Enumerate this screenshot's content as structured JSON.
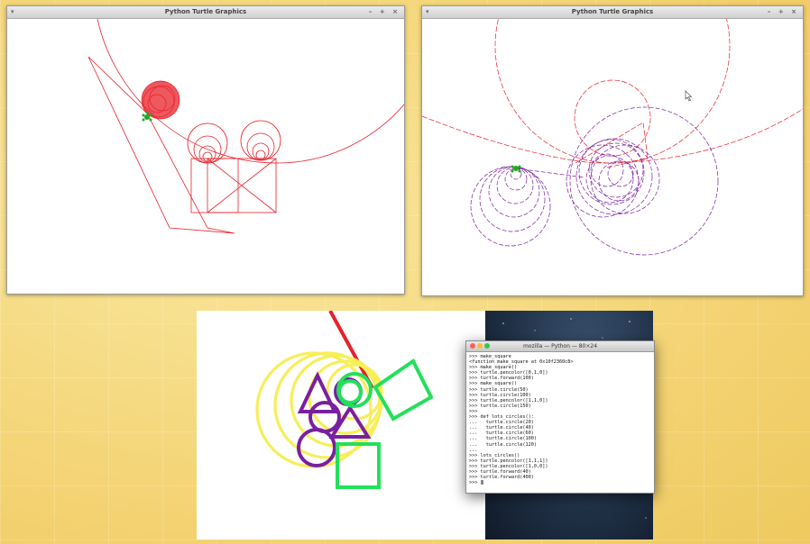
{
  "window_left": {
    "title": "Python Turtle Graphics",
    "menu": "▾",
    "controls": "– + ×"
  },
  "window_right": {
    "title": "Python Turtle Graphics",
    "menu": "▾",
    "controls": "– + ×"
  },
  "terminal": {
    "title": "mozilla — Python — 80×24",
    "lines": [
      ">>> make_square",
      "<function make_square at 0x10f2360c8>",
      ">>> make_square()",
      ">>> turtle.pencolor([0,1,0])",
      ">>> turtle.forward(100)",
      ">>> make_square()",
      ">>> turtle.circle(50)",
      ">>> turtle.circle(100)",
      ">>> turtle.pencolor([1,1,0])",
      ">>> turtle.circle(150)",
      ">>>",
      ">>> def lots_circles():",
      "...   turtle.circle(20)",
      "...   turtle.circle(40)",
      "...   turtle.circle(60)",
      "...   turtle.circle(100)",
      "...   turtle.circle(120)",
      "...",
      ">>> lots_circles()",
      ">>> turtle.pencolor([1,1,1])",
      ">>> turtle.pencolor([1,0,0])",
      ">>> turtle.forward(40)",
      ">>> turtle.forward(400)",
      ">>> "
    ]
  },
  "colors": {
    "red": "#e8202a",
    "purple": "#7a1fa0",
    "green": "#22e05a",
    "yellow": "#f7ee5a",
    "turtle": "#22aa22"
  }
}
